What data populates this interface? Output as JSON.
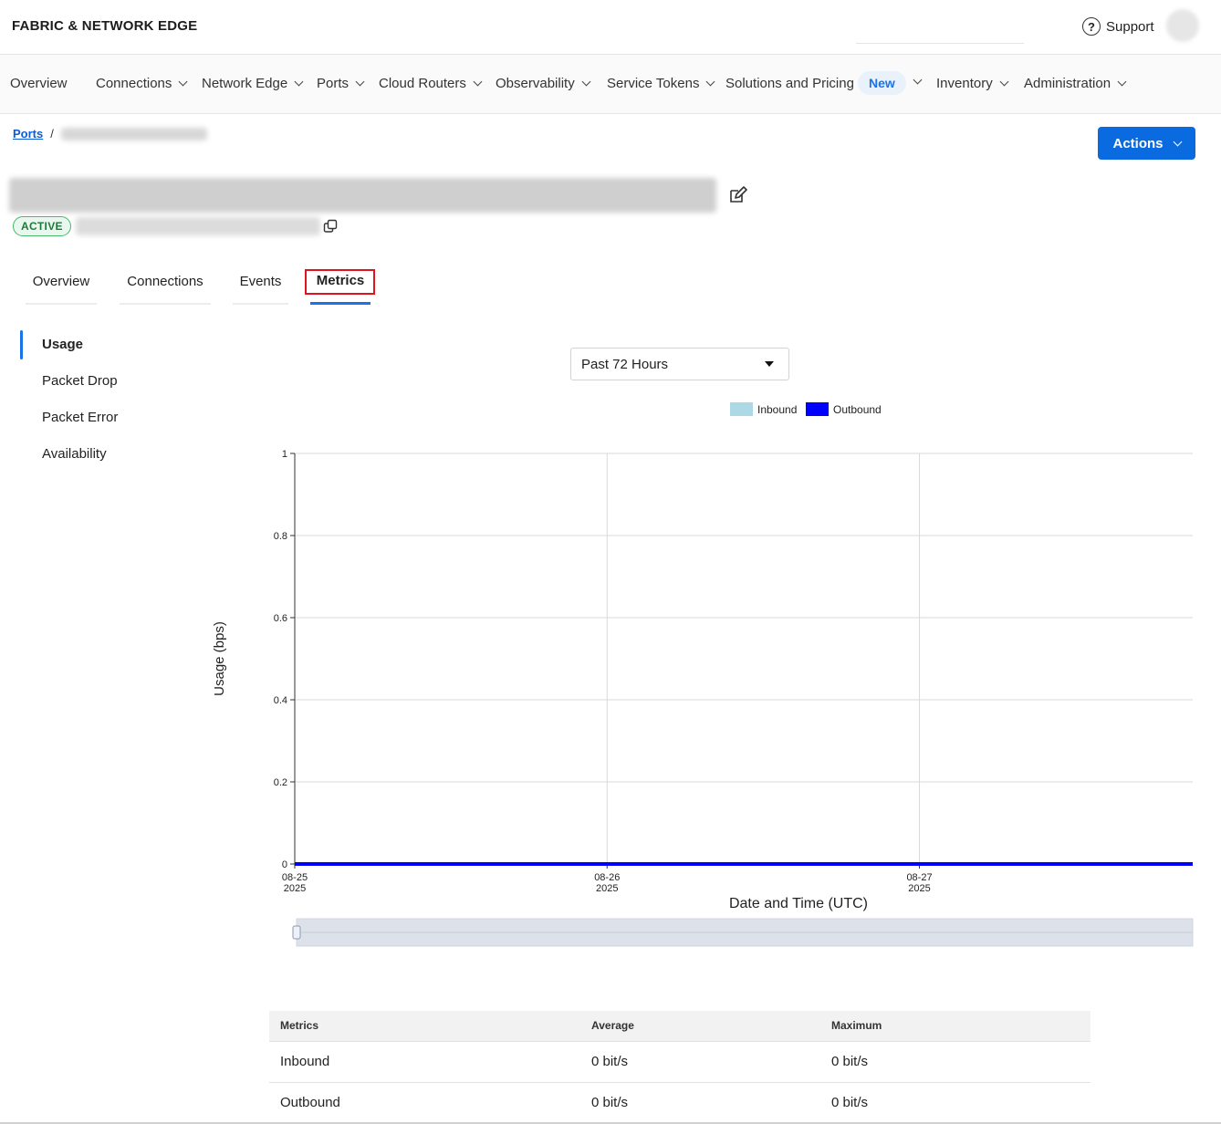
{
  "header": {
    "brand": "FABRIC & NETWORK EDGE",
    "support_label": "Support"
  },
  "nav": [
    {
      "label": "Overview",
      "has_menu": false
    },
    {
      "label": "Connections",
      "has_menu": true
    },
    {
      "label": "Network Edge",
      "has_menu": true
    },
    {
      "label": "Ports",
      "has_menu": true
    },
    {
      "label": "Cloud Routers",
      "has_menu": true
    },
    {
      "label": "Observability",
      "has_menu": true
    },
    {
      "label": "Service Tokens",
      "has_menu": true
    },
    {
      "label": "Solutions and Pricing",
      "has_menu": true,
      "badge": "New"
    },
    {
      "label": "Inventory",
      "has_menu": true
    },
    {
      "label": "Administration",
      "has_menu": true
    }
  ],
  "breadcrumb": {
    "root": "Ports",
    "separator": "/"
  },
  "page": {
    "actions_label": "Actions",
    "status": "ACTIVE"
  },
  "tabs": [
    {
      "label": "Overview",
      "active": false
    },
    {
      "label": "Connections",
      "active": false
    },
    {
      "label": "Events",
      "active": false
    },
    {
      "label": "Metrics",
      "active": true
    }
  ],
  "side_menu": [
    {
      "label": "Usage",
      "active": true
    },
    {
      "label": "Packet Drop",
      "active": false
    },
    {
      "label": "Packet Error",
      "active": false
    },
    {
      "label": "Availability",
      "active": false
    }
  ],
  "range": {
    "selected": "Past 72 Hours"
  },
  "chart_data": {
    "type": "area",
    "legend": {
      "placement": "top-center"
    },
    "series": [
      {
        "name": "Inbound",
        "color": "#add8e6",
        "values": [
          0,
          0,
          0,
          0
        ]
      },
      {
        "name": "Outbound",
        "color": "#0000ff",
        "values": [
          0,
          0,
          0,
          0
        ]
      }
    ],
    "x_ticks": [
      {
        "date": "2025-08-25",
        "label_top": "08-25",
        "label_bottom": "2025"
      },
      {
        "date": "2025-08-26",
        "label_top": "08-26",
        "label_bottom": "2025"
      },
      {
        "date": "2025-08-27",
        "label_top": "08-27",
        "label_bottom": "2025"
      }
    ],
    "x_range": [
      "2025-08-25T00:00",
      "2025-08-27T21:00"
    ],
    "y_ticks": [
      "0",
      "0.2",
      "0.4",
      "0.6",
      "0.8",
      "1"
    ],
    "ylim": [
      0,
      1
    ],
    "xlabel": "Date and Time (UTC)",
    "ylabel": "Usage (bps)",
    "grid": true
  },
  "table": {
    "headers": [
      "Metrics",
      "Average",
      "Maximum"
    ],
    "rows": [
      [
        "Inbound",
        "0 bit/s",
        "0 bit/s"
      ],
      [
        "Outbound",
        "0 bit/s",
        "0 bit/s"
      ]
    ]
  }
}
